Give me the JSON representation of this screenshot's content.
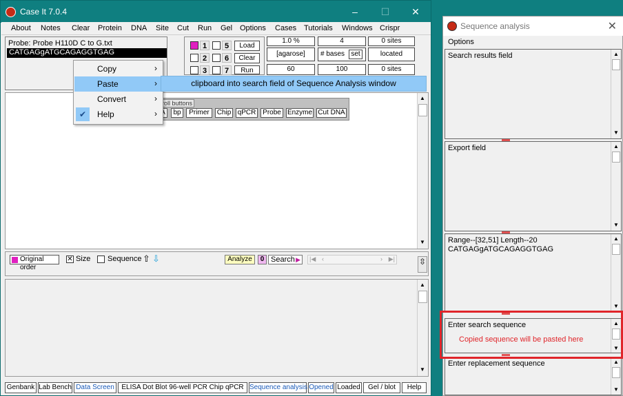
{
  "main_window": {
    "title": "Case It 7.0.4",
    "controls": {
      "minimize": "–",
      "maximize": "☐",
      "close": "✕"
    },
    "menu": [
      "About",
      "Notes",
      "Clear",
      "Protein",
      "DNA",
      "Site",
      "Cut",
      "Run",
      "Gel",
      "Options",
      "Cases",
      "Tutorials",
      "Windows",
      "Crispr"
    ]
  },
  "probe": {
    "label": "Probe: Probe  H110D C to G.txt",
    "sequence": "CATGAGgATGCAGAGGTGAG"
  },
  "lanes": {
    "numbers": [
      "1",
      "5",
      "2",
      "6",
      "3",
      "7"
    ],
    "buttons": {
      "load": "Load",
      "clear": "Clear",
      "run": "Run"
    }
  },
  "gel_params": {
    "agarose_value": "1.0 %",
    "agarose_label": "[agarose]",
    "volts": "60",
    "bases_value": "4",
    "bases_label": "# bases",
    "set_label": "set",
    "bases_num": "100",
    "sites_top": "0  sites",
    "located": "located",
    "sites_bottom": "0  sites"
  },
  "context_menu": {
    "items": [
      {
        "label": "Copy",
        "has_submenu": true,
        "checked": false
      },
      {
        "label": "Paste",
        "has_submenu": true,
        "checked": false,
        "highlighted": true
      },
      {
        "label": "Convert",
        "has_submenu": true,
        "checked": false
      },
      {
        "label": "Help",
        "has_submenu": true,
        "checked": true
      }
    ],
    "submenu_item": "clipboard into search field of Sequence Analysis window"
  },
  "scroll_toolbar": {
    "header": "roll buttons",
    "buttons": [
      "A",
      "bp",
      "Primer",
      "Chip",
      "qPCR",
      "Probe",
      "Enzyme",
      "Cut DNA"
    ]
  },
  "mid_toolbar": {
    "original_order": "Original order",
    "size_label": "Size",
    "sequence_label": "Sequence",
    "analyze": "Analyze",
    "zero": "0",
    "search": "Search"
  },
  "status_tabs": [
    "Genbank",
    "Lab Bench",
    "Data Screen",
    "ELISA  Dot Blot  96-well PCR  Chip  qPCR",
    "Sequence analysis",
    "Opened",
    "Loaded",
    "Gel / blot",
    "Help"
  ],
  "sequence_analysis": {
    "title": "Sequence analysis",
    "options": "Options",
    "panes": {
      "search_results": "Search results field",
      "export": "Export field",
      "range_line": "Range--[32,51]  Length--20",
      "range_sequence": "CATGAGgATGCAGAGGTGAG",
      "enter_search": "Enter search sequence",
      "annotation": "Copied sequence will be pasted here",
      "enter_replacement": "Enter replacement sequence"
    }
  },
  "colors": {
    "desktop": "#0f7f80",
    "highlight": "#91c9f7",
    "annotation_red": "#e0252a",
    "magenta": "#e020c0"
  }
}
